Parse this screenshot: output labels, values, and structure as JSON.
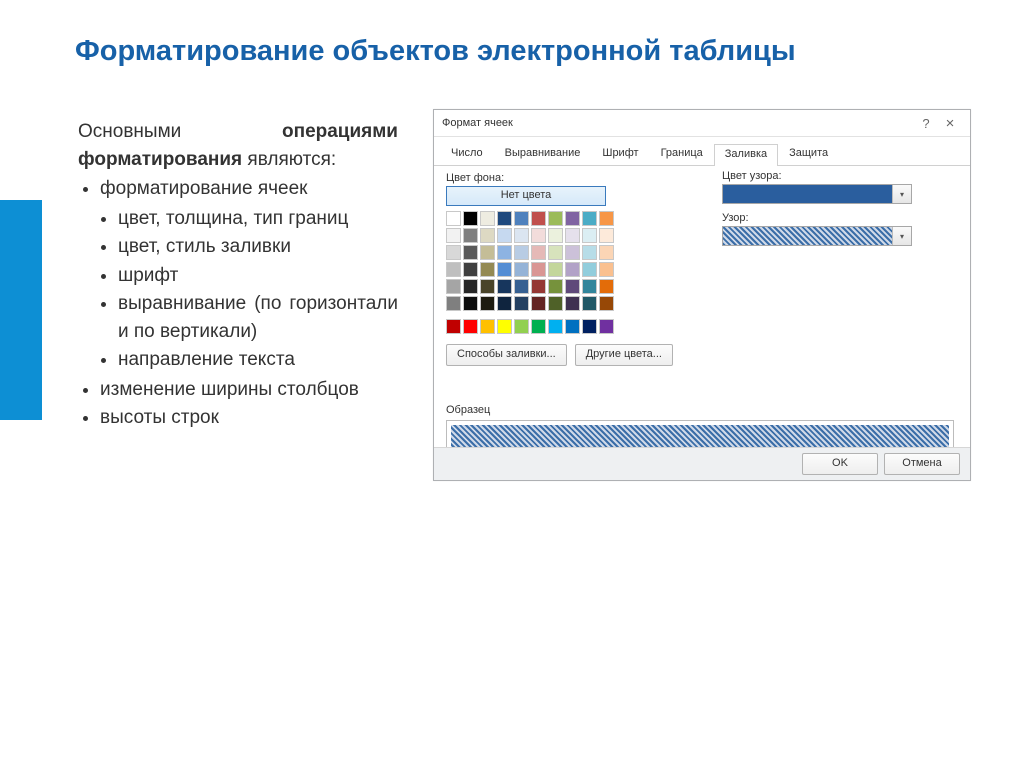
{
  "slide": {
    "title": "Форматирование объектов электронной таблицы",
    "intro_part1": "Основными ",
    "intro_bold": "операциями форматирования",
    "intro_part2": " являются:",
    "bullets1": [
      "форматирование ячеек"
    ],
    "bullets2": [
      "цвет, толщина, тип границ",
      "цвет, стиль заливки",
      "шрифт",
      "выравнивание (по горизонтали и по вертикали)",
      "направление текста"
    ],
    "bullets3": [
      "изменение ширины столбцов",
      "высоты строк"
    ]
  },
  "dialog": {
    "title": "Формат ячеек",
    "tabs": [
      "Число",
      "Выравнивание",
      "Шрифт",
      "Граница",
      "Заливка",
      "Защита"
    ],
    "active_tab": 4,
    "bg_label": "Цвет фона:",
    "no_color": "Нет цвета",
    "pattern_color_label": "Цвет узора:",
    "pattern_label": "Узор:",
    "fill_methods": "Способы заливки...",
    "other_colors": "Другие цвета...",
    "sample_label": "Образец",
    "ok": "OK",
    "cancel": "Отмена",
    "theme_colors": [
      "#ffffff",
      "#000000",
      "#eeece1",
      "#1f497d",
      "#4f81bd",
      "#c0504d",
      "#9bbb59",
      "#8064a2",
      "#4bacc6",
      "#f79646"
    ],
    "palette": [
      "#f2f2f2",
      "#7f7f7f",
      "#ddd9c3",
      "#c6d9f0",
      "#dbe5f1",
      "#f2dcdb",
      "#ebf1dd",
      "#e5e0ec",
      "#dbeef3",
      "#fdeada",
      "#d8d8d8",
      "#595959",
      "#c4bd97",
      "#8db3e2",
      "#b8cce4",
      "#e5b9b7",
      "#d7e3bc",
      "#ccc1d9",
      "#b7dde8",
      "#fbd5b5",
      "#bfbfbf",
      "#3f3f3f",
      "#938953",
      "#548dd4",
      "#95b3d7",
      "#d99694",
      "#c3d69b",
      "#b2a2c7",
      "#92cddc",
      "#fac08f",
      "#a5a5a5",
      "#262626",
      "#494429",
      "#17365d",
      "#366092",
      "#953734",
      "#76923c",
      "#5f497a",
      "#31859b",
      "#e36c09",
      "#7f7f7f",
      "#0c0c0c",
      "#1d1b10",
      "#0f243e",
      "#244061",
      "#632423",
      "#4f6128",
      "#3f3151",
      "#205867",
      "#974806"
    ],
    "standard_colors": [
      "#c00000",
      "#ff0000",
      "#ffc000",
      "#ffff00",
      "#92d050",
      "#00b050",
      "#00b0f0",
      "#0070c0",
      "#002060",
      "#7030a0"
    ]
  }
}
